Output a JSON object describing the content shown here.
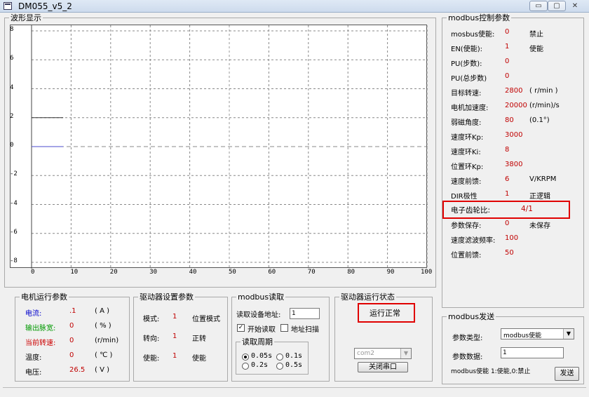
{
  "window": {
    "title": "DM055_v5_2",
    "min": "▭",
    "max": "▢",
    "close": "✕"
  },
  "wave": {
    "legend": "波形显示",
    "y_ticks": [
      "8",
      "6",
      "4",
      "2",
      "0",
      "-2",
      "-4",
      "-6",
      "-8"
    ],
    "x_ticks": [
      "0",
      "10",
      "20",
      "30",
      "40",
      "50",
      "60",
      "70",
      "80",
      "90",
      "100"
    ]
  },
  "modbus_params": {
    "legend": "modbus控制参数",
    "rows": [
      {
        "label": "mosbus使能:",
        "value": "0",
        "unit": "禁止"
      },
      {
        "label": "EN(使能):",
        "value": "1",
        "unit": "使能"
      },
      {
        "label": "PU(步数):",
        "value": "0",
        "unit": ""
      },
      {
        "label": "PU(总步数)",
        "value": "0",
        "unit": ""
      },
      {
        "label": "目标转速:",
        "value": "2800",
        "unit": "( r/min )"
      },
      {
        "label": "电机加速度:",
        "value": "20000",
        "unit": "(r/min)/s"
      },
      {
        "label": "弱磁角度:",
        "value": "80",
        "unit": "(0.1°)"
      },
      {
        "label": "速度环Kp:",
        "value": "3000",
        "unit": ""
      },
      {
        "label": "速度环Ki:",
        "value": "8",
        "unit": ""
      },
      {
        "label": "位置环Kp:",
        "value": "3800",
        "unit": ""
      },
      {
        "label": "速度前馈:",
        "value": "6",
        "unit": "V/KRPM"
      },
      {
        "label": "DIR极性",
        "value": "1",
        "unit": "正逻辑"
      },
      {
        "label": "电子齿轮比:",
        "value": "4/1",
        "unit": ""
      },
      {
        "label": "参数保存:",
        "value": "0",
        "unit": "未保存"
      },
      {
        "label": "速度滤波频率:",
        "value": "100",
        "unit": ""
      },
      {
        "label": "位置前馈:",
        "value": "50",
        "unit": ""
      }
    ]
  },
  "motor": {
    "legend": "电机运行参数",
    "rows": [
      {
        "label": "电流:",
        "value": ".1",
        "unit": "( A )",
        "color": "#0000cc"
      },
      {
        "label": "输出脉宽:",
        "value": "0",
        "unit": "( % )",
        "color": "#009900"
      },
      {
        "label": "当前转速:",
        "value": "0",
        "unit": "(r/min)",
        "color": "#cc0000"
      },
      {
        "label": "温度:",
        "value": "0",
        "unit": "( ℃ )",
        "color": "#000000"
      },
      {
        "label": "电压:",
        "value": "26.5",
        "unit": "( V )",
        "color": "#000000"
      }
    ]
  },
  "driver": {
    "legend": "驱动器设置参数",
    "rows": [
      {
        "label": "模式:",
        "value": "1",
        "text": "位置模式"
      },
      {
        "label": "转向:",
        "value": "1",
        "text": "正转"
      },
      {
        "label": "使能:",
        "value": "1",
        "text": "使能"
      }
    ]
  },
  "read": {
    "legend": "modbus读取",
    "addr_label": "读取设备地址:",
    "addr_value": "1",
    "start_read": "开始读取",
    "addr_scan": "地址扫描",
    "period_legend": "读取周期",
    "periods": [
      "0.05s",
      "0.1s",
      "0.2s",
      "0.5s"
    ]
  },
  "status": {
    "legend": "驱动器运行状态",
    "state": "运行正常",
    "port": "com2",
    "close_port": "关闭串口"
  },
  "send": {
    "legend": "modbus发送",
    "type_label": "参数类型:",
    "type_value": "modbus使能",
    "data_label": "参数数据:",
    "data_value": "1",
    "hint": "modbus使能 1:使能,0:禁止",
    "send_btn": "发送"
  }
}
